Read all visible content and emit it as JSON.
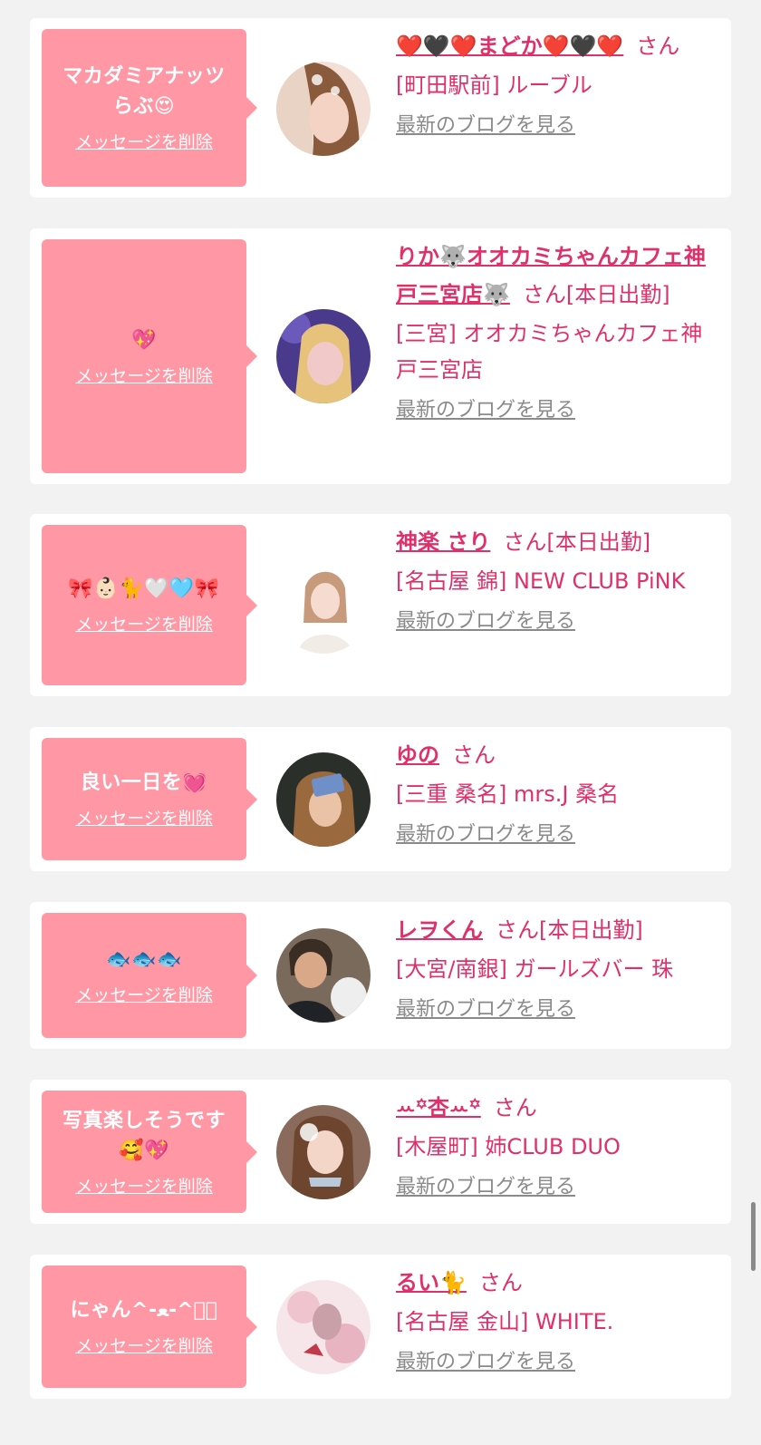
{
  "common": {
    "delete_label": "メッセージを削除",
    "blog_label": "最新のブログを見る"
  },
  "items": [
    {
      "message": "マカダミアナッツ\nらぶ😍",
      "name": "❤️🖤❤️まどか❤️🖤❤️",
      "suffix": "さん",
      "store": "[町田駅前] ルーブル"
    },
    {
      "message": "💖",
      "name": "りか🐺オオカミちゃんカフェ神戸三宮店🐺",
      "suffix": "さん[本日出勤]",
      "store": "[三宮] オオカミちゃんカフェ神戸三宮店"
    },
    {
      "message": "🎀👶🏻🐈🤍🩵🎀",
      "name": "神楽 さり",
      "suffix": "さん[本日出勤]",
      "store": "[名古屋 錦] NEW CLUB PiNK"
    },
    {
      "message": "良い一日を💓",
      "name": "ゆの",
      "suffix": "さん",
      "store": "[三重 桑名] mrs.J 桑名"
    },
    {
      "message": "🐟🐟🐟",
      "name": "レヲくん",
      "suffix": "さん[本日出勤]",
      "store": "[大宮/南銀] ガールズバー 珠"
    },
    {
      "message": "写真楽しそうです\n🥰💖",
      "name": "ꕀ꙳杏ꕀ꙳",
      "suffix": "さん",
      "store": "[木屋町] 姉CLUB DUO"
    },
    {
      "message": "にゃん^-ﻌ-^ฅ゙",
      "name": "るい🐈",
      "suffix": "さん",
      "store": "[名古屋 金山] WHITE."
    }
  ],
  "colors": {
    "bubble": "#ff97a4",
    "accent": "#e0306a",
    "link_gray": "#8a8a8a"
  }
}
